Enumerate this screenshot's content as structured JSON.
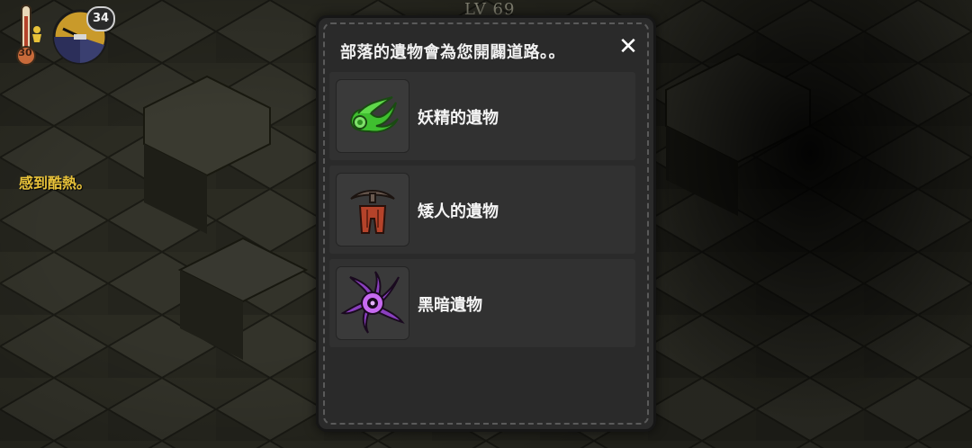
{
  "hud": {
    "temperature": "30",
    "day_count": "34",
    "status_message": "感到酷熱。",
    "level_text": "LV 69"
  },
  "dialog": {
    "title": "部落的遺物會為您開闢道路。。",
    "close_label": "✕",
    "items": [
      {
        "label": "妖精的遺物",
        "icon": "green-leaf-relic-icon"
      },
      {
        "label": "矮人的遺物",
        "icon": "dwarf-pickaxe-relic-icon"
      },
      {
        "label": "黑暗遺物",
        "icon": "dark-tentacle-relic-icon"
      }
    ]
  },
  "colors": {
    "status_text": "#e8c23a",
    "dialog_bg": "#2a2a2a",
    "list_item_bg": "#313131"
  }
}
